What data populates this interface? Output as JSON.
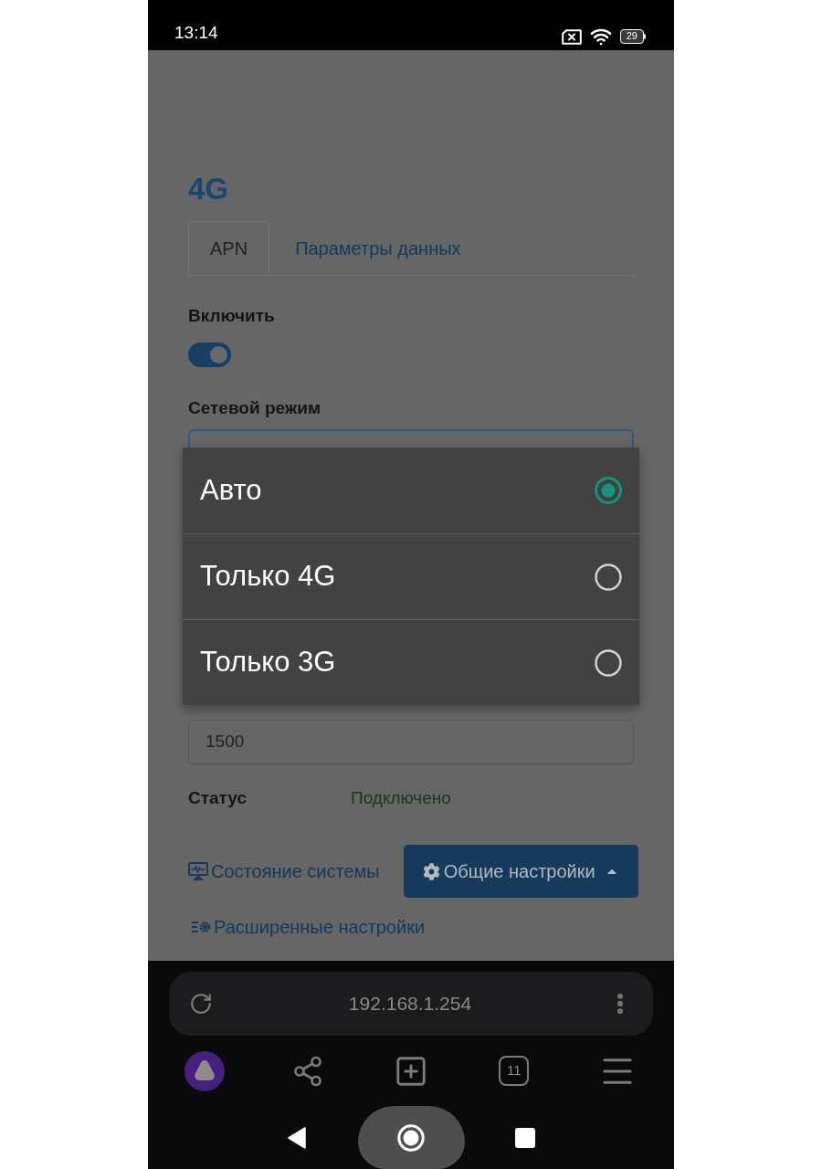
{
  "status_bar": {
    "time": "13:14",
    "battery": "29"
  },
  "page": {
    "title": "4G",
    "tabs": [
      {
        "label": "APN",
        "selected": true
      },
      {
        "label": "Параметры данных",
        "selected": false
      }
    ],
    "enable": {
      "label": "Включить",
      "on": true
    },
    "network_mode": {
      "label": "Сетевой режим"
    },
    "input": {
      "value": "1500"
    },
    "status": {
      "label": "Статус",
      "value": "Подключено"
    },
    "system_status_link": {
      "label": "Состояние системы"
    },
    "settings_button": {
      "label": "Общие настройки",
      "expanded": true
    },
    "advanced_link": {
      "label": "Расширенные настройки"
    }
  },
  "dropdown": {
    "options": [
      {
        "label": "Авто",
        "selected": true
      },
      {
        "label": "Только 4G",
        "selected": false
      },
      {
        "label": "Только 3G",
        "selected": false
      }
    ]
  },
  "browser": {
    "url": "192.168.1.254",
    "tab_count": "11"
  }
}
